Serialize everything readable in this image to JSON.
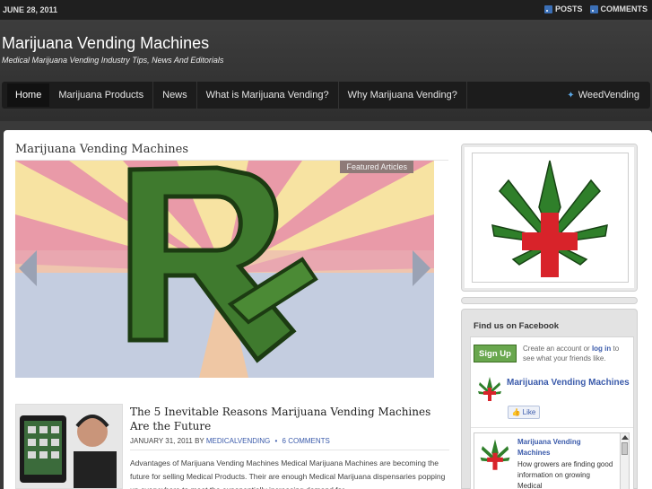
{
  "topbar": {
    "date": "JUNE 28, 2011",
    "posts_label": "POSTS",
    "comments_label": "COMMENTS"
  },
  "header": {
    "site_title": "Marijuana Vending Machines",
    "tagline": "Medical Marijuana Vending Industry Tips, News And Editorials"
  },
  "nav": {
    "items": [
      {
        "label": "Home",
        "active": true
      },
      {
        "label": "Marijuana Products"
      },
      {
        "label": "News"
      },
      {
        "label": "What is Marijuana Vending?"
      },
      {
        "label": "Why Marijuana Vending?"
      }
    ],
    "twitter_label": "WeedVending"
  },
  "main": {
    "section_title": "Marijuana Vending Machines",
    "featured_tag": "Featured Articles",
    "post": {
      "title": "The 5 Inevitable Reasons Marijuana Vending Machines Are the Future",
      "date": "JANUARY 31, 2011",
      "by": "BY",
      "author": "MEDICALVENDING",
      "comments": "6 COMMENTS",
      "excerpt": "Advantages of Marijuana Vending Machines Medical Marijuana Machines are becoming the future for selling Medical Products. Their are enough Medical Marijuana dispensaries popping up everywhere to meet the exponentially increasing demand for"
    }
  },
  "sidebar": {
    "facebook": {
      "heading": "Find us on Facebook",
      "signup": "Sign Up",
      "create_text_pre": "Create an account or ",
      "login_text": "log in",
      "create_text_post": " to see what your friends like.",
      "page_name": "Marijuana Vending Machines",
      "like": "Like",
      "feed_name": "Marijuana Vending Machines",
      "feed_text": "How growers are finding good information on growing Medical"
    }
  },
  "colors": {
    "link": "#3b5bab",
    "signup_green": "#69a74e",
    "cross_red": "#d8232a",
    "leaf_green": "#2f7f2a"
  }
}
